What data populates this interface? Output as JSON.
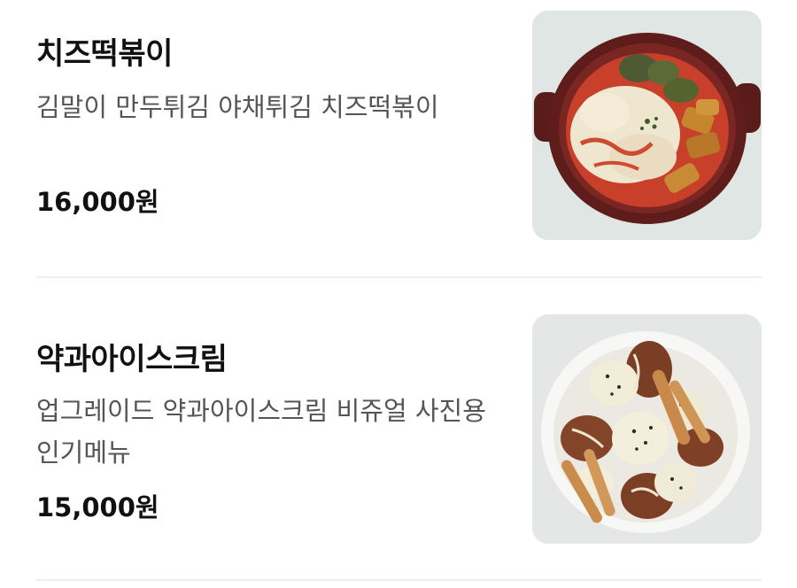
{
  "menu": {
    "items": [
      {
        "name": "치즈떡볶이",
        "description": "김말이 만두튀김 야채튀김 치즈떡볶이",
        "price": "16,000원"
      },
      {
        "name": "약과아이스크림",
        "description": "업그레이드 약과아이스크림 비쥬얼 사진용 인기메뉴",
        "price": "15,000원"
      }
    ]
  },
  "colors": {
    "title": "#111111",
    "description": "#555555",
    "divider": "#eeeeee"
  }
}
